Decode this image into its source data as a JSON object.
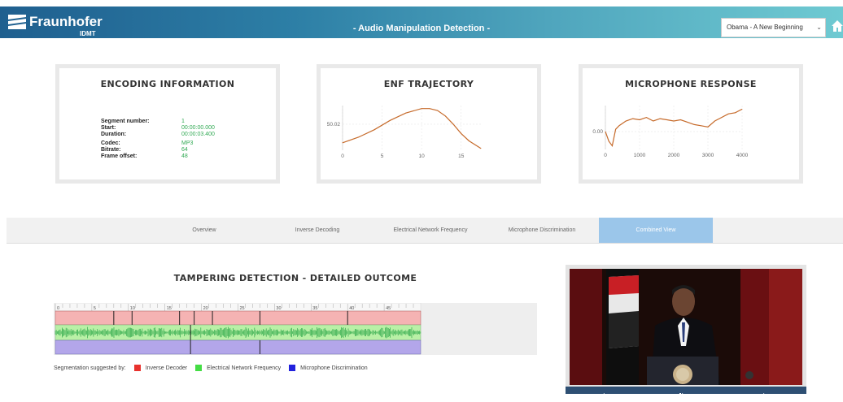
{
  "header": {
    "logo_text": "Fraunhofer",
    "logo_sub": "IDMT",
    "title": "- Audio Manipulation Detection -",
    "selected_audio": "Obama - A New Beginning"
  },
  "encoding": {
    "title": "ENCODING INFORMATION",
    "rows": [
      {
        "label": "Segment number:",
        "value": "1"
      },
      {
        "label": "Start:",
        "value": "00:00:00.000"
      },
      {
        "label": "Duration:",
        "value": "00:00:03.400"
      },
      {
        "label": "Codec:",
        "value": "MP3"
      },
      {
        "label": "Bitrate:",
        "value": "64"
      },
      {
        "label": "Frame offset:",
        "value": "48"
      }
    ]
  },
  "enf": {
    "title": "ENF TRAJECTORY",
    "chart_data": {
      "type": "line",
      "x": [
        0,
        2,
        4,
        6,
        8,
        10,
        11,
        12,
        13,
        14,
        15,
        16,
        17.5
      ],
      "y": [
        49.97,
        49.985,
        50.005,
        50.03,
        50.05,
        50.062,
        50.062,
        50.057,
        50.042,
        50.02,
        49.995,
        49.975,
        49.955
      ],
      "xticks": [
        "0",
        "5",
        "10",
        "15"
      ],
      "yticks": [
        "50.02"
      ],
      "xlim": [
        0,
        17.5
      ],
      "ylim": [
        49.95,
        50.07
      ]
    }
  },
  "mic": {
    "title": "MICROPHONE RESPONSE",
    "chart_data": {
      "type": "line",
      "x": [
        0,
        100,
        200,
        300,
        400,
        600,
        800,
        1000,
        1200,
        1400,
        1600,
        1800,
        2000,
        2200,
        2400,
        2600,
        2800,
        3000,
        3200,
        3400,
        3600,
        3800,
        4000
      ],
      "y": [
        0.0,
        -0.8,
        -1.2,
        0.2,
        0.5,
        0.9,
        1.1,
        1.0,
        1.2,
        0.9,
        1.1,
        1.0,
        0.9,
        1.0,
        0.8,
        0.6,
        0.5,
        0.4,
        0.9,
        1.2,
        1.5,
        1.6,
        1.9
      ],
      "xticks": [
        "0",
        "1000",
        "2000",
        "3000",
        "4000"
      ],
      "yticks": [
        "0.00"
      ],
      "xlim": [
        0,
        4000
      ],
      "ylim": [
        -1.5,
        2.2
      ]
    }
  },
  "tabs": [
    {
      "label": "Overview",
      "active": false
    },
    {
      "label": "Inverse Decoding",
      "active": false
    },
    {
      "label": "Electrical Network Frequency",
      "active": false
    },
    {
      "label": "Microphone Discrimination",
      "active": false
    },
    {
      "label": "Combined View",
      "active": true
    }
  ],
  "tampering": {
    "title": "TAMPERING DETECTION - DETAILED OUTCOME",
    "ruler_labels": [
      "0",
      "5",
      "10",
      "15",
      "20",
      "25",
      "30",
      "35",
      "40",
      "45"
    ],
    "ruler_max": 50,
    "inverse_decoder_markers": [
      8,
      10.5,
      17,
      19,
      21.5,
      28,
      40
    ],
    "enf_markers": [
      18.5
    ],
    "mic_markers": [
      18.5,
      28
    ],
    "legend_label": "Segmentation suggested by:",
    "legend": [
      {
        "name": "Inverse Decoder",
        "color": "#e8322e"
      },
      {
        "name": "Electrical Network Frequency",
        "color": "#44dd44"
      },
      {
        "name": "Microphone Discrimination",
        "color": "#2222dd"
      }
    ]
  },
  "colors": {
    "chart_line": "#c66a2a",
    "red_band": "#f5b3b3",
    "green_band": "#b9f0a6",
    "blue_band": "#b3a6ea",
    "wave": "#2ea84a"
  }
}
